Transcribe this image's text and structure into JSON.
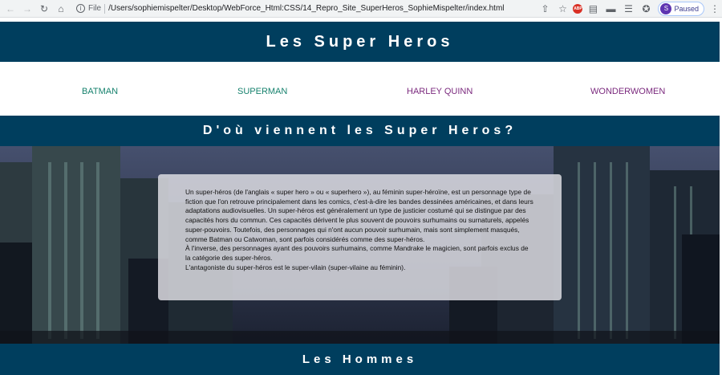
{
  "browser": {
    "url_scheme_label": "File",
    "url": "/Users/sophiemispelter/Desktop/WebForce_Html:CSS/14_Repro_Site_SuperHeros_SophieMispelter/index.html",
    "profile_initial": "S",
    "profile_status": "Paused",
    "adblock_label": "ABP"
  },
  "site": {
    "title": "Les Super Heros",
    "nav": [
      {
        "label": "BATMAN",
        "color": "#17826e"
      },
      {
        "label": "SUPERMAN",
        "color": "#17826e"
      },
      {
        "label": "HARLEY QUINN",
        "color": "#7b2a7e"
      },
      {
        "label": "WONDERWOMEN",
        "color": "#7b2a7e"
      }
    ],
    "section_origin_title": "D'où viennent les Super Heros?",
    "intro_paragraphs": [
      "Un super-héros (de l'anglais « super hero » ou « superhero »), au féminin super-héroïne, est un personnage type de fiction que l'on retrouve principalement dans les comics, c'est-à-dire les bandes dessinées américaines, et dans leurs adaptations audiovisuelles. Un super-héros est généralement un type de justicier costumé qui se distingue par des capacités hors du commun. Ces capacités dérivent le plus souvent de pouvoirs surhumains ou surnaturels, appelés super-pouvoirs. Toutefois, des personnages qui n'ont aucun pouvoir surhumain, mais sont simplement masqués, comme Batman ou Catwoman, sont parfois considérés comme des super-héros.",
      "À l'inverse, des personnages ayant des pouvoirs surhumains, comme Mandrake le magicien, sont parfois exclus de la catégorie des super-héros.",
      "L'antagoniste du super-héros est le super-vilain (super-vilaine au féminin)."
    ],
    "section_men_title": "Les Hommes"
  }
}
